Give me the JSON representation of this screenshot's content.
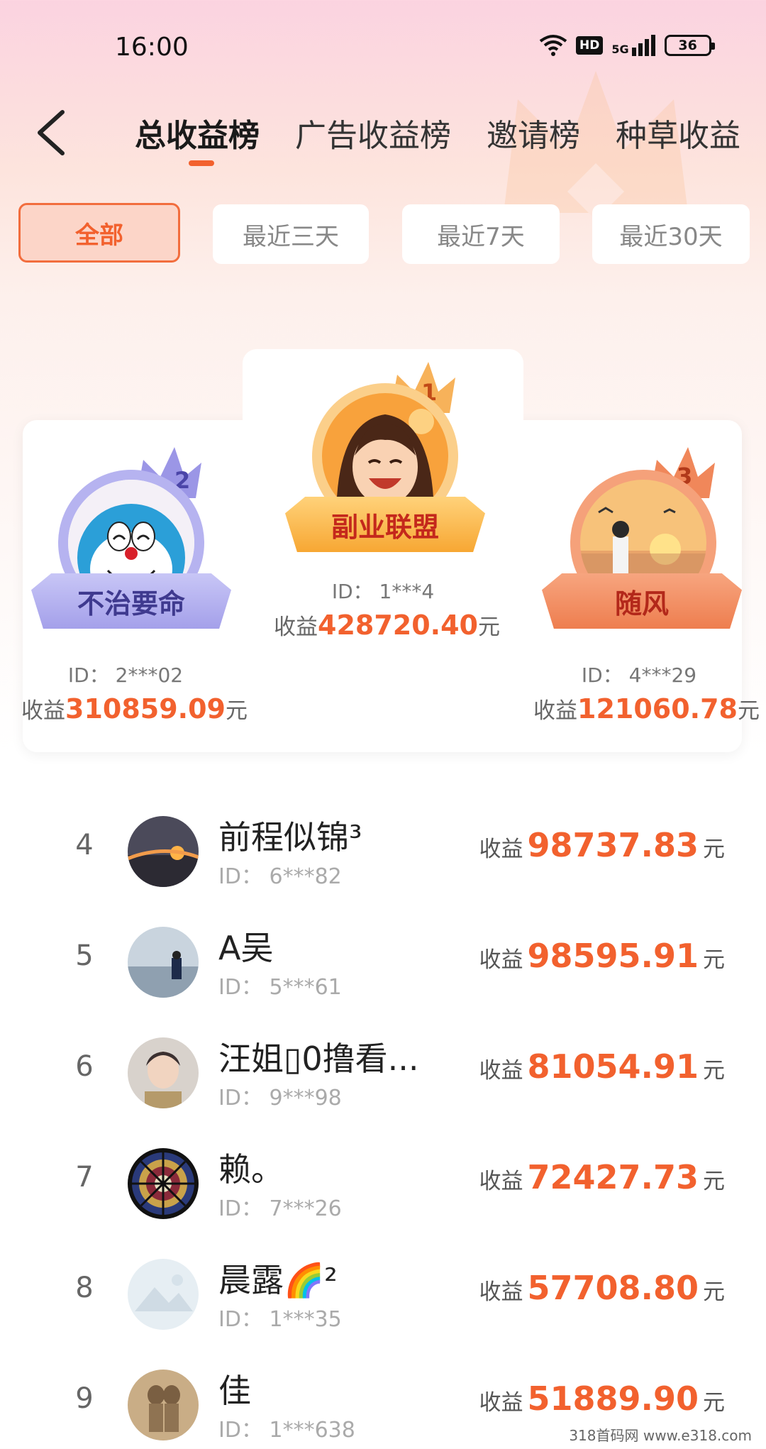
{
  "status_bar": {
    "time": "16:00",
    "hd": "HD",
    "network": "5G",
    "battery": "36"
  },
  "tabs": [
    {
      "label": "总收益榜",
      "active": true
    },
    {
      "label": "广告收益榜",
      "active": false
    },
    {
      "label": "邀请榜",
      "active": false
    },
    {
      "label": "种草收益",
      "active": false
    }
  ],
  "filters": [
    {
      "label": "全部",
      "active": true
    },
    {
      "label": "最近三天",
      "active": false
    },
    {
      "label": "最近7天",
      "active": false
    },
    {
      "label": "最近30天",
      "active": false
    }
  ],
  "podium": {
    "first": {
      "rank": "1",
      "name": "副业联盟",
      "id": "ID：  1***4",
      "income_label": "收益",
      "income": "428720.40",
      "unit": "元"
    },
    "second": {
      "rank": "2",
      "name": "不治要命",
      "id": "ID：  2***02",
      "income_label": "收益",
      "income": "310859.09",
      "unit": "元"
    },
    "third": {
      "rank": "3",
      "name": "随风",
      "id": "ID：  4***29",
      "income_label": "收益",
      "income": "121060.78",
      "unit": "元"
    }
  },
  "leaderboard": [
    {
      "rank": "4",
      "name": "前程似锦³",
      "id": "ID：  6***82",
      "income_label": "收益",
      "income": "98737.83",
      "unit": "元"
    },
    {
      "rank": "5",
      "name": "A吴",
      "id": "ID：  5***61",
      "income_label": "收益",
      "income": "98595.91",
      "unit": "元"
    },
    {
      "rank": "6",
      "name": "汪姐▯0撸看...",
      "id": "ID：  9***98",
      "income_label": "收益",
      "income": "81054.91",
      "unit": "元"
    },
    {
      "rank": "7",
      "name": "赖。",
      "id": "ID：  7***26",
      "income_label": "收益",
      "income": "72427.73",
      "unit": "元"
    },
    {
      "rank": "8",
      "name": "晨露🌈²",
      "id": "ID：  1***35",
      "income_label": "收益",
      "income": "57708.80",
      "unit": "元"
    },
    {
      "rank": "9",
      "name": "佳",
      "id": "ID：  1***638",
      "income_label": "收益",
      "income": "51889.90",
      "unit": "元"
    }
  ],
  "watermark": "318首码网   www.e318.com",
  "colors": {
    "accent": "#f2612e",
    "gold": "#f6a33a",
    "silver": "#a9a6ea",
    "bronze": "#f08a5d"
  }
}
